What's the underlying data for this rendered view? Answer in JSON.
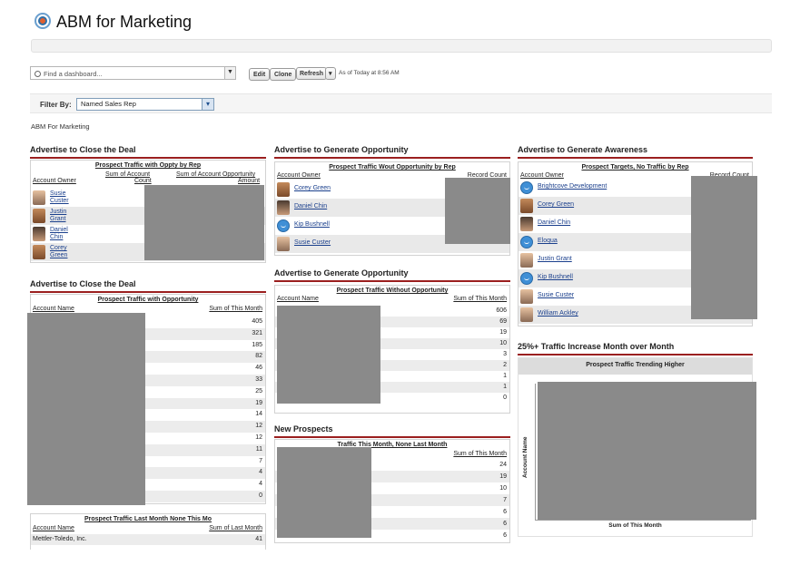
{
  "app": {
    "title": "ABM for Marketing",
    "icon": "abm-logo-icon"
  },
  "toolbar": {
    "find_placeholder": "Find a dashboard...",
    "edit": "Edit",
    "clone": "Clone",
    "refresh": "Refresh",
    "refresh_menu": "▾",
    "as_of": "As of Today at 8:56 AM"
  },
  "filter": {
    "label": "Filter By:",
    "value": "Named Sales Rep"
  },
  "dashboard_name": "ABM For Marketing",
  "col1": {
    "c1": {
      "title": "Advertise to Close the Deal",
      "panel_title": "Prospect Traffic with Oppty by Rep",
      "h_owner": "Account Owner",
      "h_sum1a": "Sum of Account",
      "h_sum1b": "Count",
      "h_sum2a": "Sum of Account Opportunity",
      "h_sum2b": "Amount",
      "rows": [
        {
          "first": "Susie",
          "last": "Custer"
        },
        {
          "first": "Justin",
          "last": "Grant"
        },
        {
          "first": "Daniel",
          "last": "Chin"
        },
        {
          "first": "Corey",
          "last": "Green"
        }
      ]
    },
    "c2": {
      "title": "Advertise to Close the Deal",
      "panel_title": "Prospect Traffic with Opportunity",
      "h_name": "Account Name",
      "h_sum": "Sum of This Month",
      "values": [
        "405",
        "321",
        "185",
        "82",
        "46",
        "33",
        "25",
        "19",
        "14",
        "12",
        "12",
        "11",
        "7",
        "4",
        "4",
        "0"
      ]
    },
    "c3": {
      "panel_title": "Prospect Traffic Last Month None This Mo",
      "h_name": "Account Name",
      "h_sum": "Sum of Last Month",
      "row_name": "Mettler-Toledo, Inc.",
      "row_value": "41"
    }
  },
  "col2": {
    "c1": {
      "title": "Advertise to Generate Opportunity",
      "panel_title": "Prospect Traffic Wout Opportunity by Rep",
      "h_owner": "Account Owner",
      "h_count": "Record Count",
      "rows": [
        "Corey Green",
        "Daniel Chin",
        "Kip Bushnell",
        "Susie Custer"
      ]
    },
    "c2": {
      "title": "Advertise to Generate Opportunity",
      "panel_title": "Prospect Traffic Without Opportunity",
      "h_name": "Account Name",
      "h_sum": "Sum of This Month",
      "values": [
        "606",
        "69",
        "19",
        "10",
        "3",
        "2",
        "1",
        "1",
        "0"
      ]
    },
    "c3": {
      "title": "New Prospects",
      "panel_title": "Traffic This Month, None Last Month",
      "h_sum": "Sum of This Month",
      "values": [
        "24",
        "19",
        "10",
        "7",
        "6",
        "6",
        "6"
      ]
    }
  },
  "col3": {
    "c1": {
      "title": "Advertise to Generate Awareness",
      "panel_title": "Prospect Targets, No Traffic by Rep",
      "h_owner": "Account Owner",
      "h_count": "Record Count",
      "rows": [
        "Brightcove Development",
        "Corey Green",
        "Daniel Chin",
        "Eloqua",
        "Justin Grant",
        "Kip Bushnell",
        "Susie Custer",
        "William Ackley"
      ]
    },
    "c2": {
      "title": "25%+ Traffic Increase Month over Month",
      "panel_title": "Prospect Traffic Trending Higher",
      "y_label": "Account Name",
      "x_label": "Sum of This Month"
    }
  }
}
